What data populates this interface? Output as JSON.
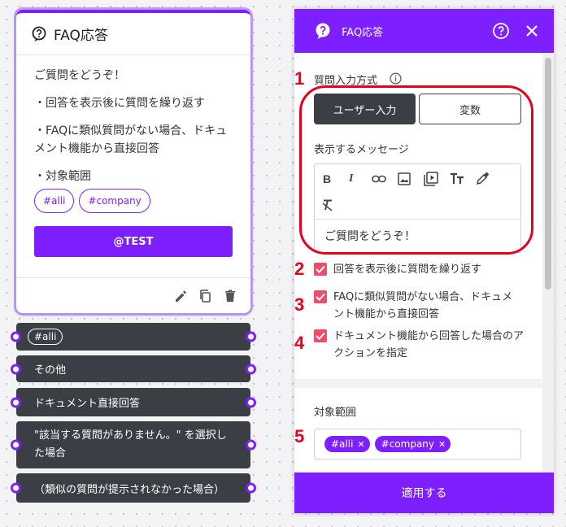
{
  "node": {
    "title": "FAQ応答",
    "lines": [
      "ご質問をどうぞ！",
      "・回答を表示後に質問を繰り返す",
      "・FAQに類似質問がない場合、ドキュメント機能から直接回答",
      "・対象範囲"
    ],
    "chips": [
      "#alli",
      "#company"
    ],
    "test_button": "@TEST"
  },
  "branches": [
    {
      "label": "#alli"
    },
    {
      "label": "その他"
    },
    {
      "label": "ドキュメント直接回答"
    },
    {
      "label": "\"該当する質問がありません。\" を選択した場合"
    },
    {
      "label": "（類似の質問が提示されなかった場合）"
    }
  ],
  "panel": {
    "title": "FAQ応答",
    "input_method_label": "質問入力方式",
    "toggle_user": "ユーザー入力",
    "toggle_var": "変数",
    "message_label": "表示するメッセージ",
    "editor_text": "ご質問をどうぞ！",
    "checkboxes": [
      {
        "text": "回答を表示後に質問を繰り返す",
        "checked": true
      },
      {
        "text": "FAQに類似質問がない場合、ドキュメント機能から直接回答",
        "checked": true
      },
      {
        "text": "ドキュメント機能から回答した場合のアクションを指定",
        "checked": true
      }
    ],
    "scope_label": "対象範囲",
    "scope_tags": [
      "#alli",
      "#company"
    ],
    "apply_button": "適用する"
  },
  "annotations": [
    "1",
    "2",
    "3",
    "4",
    "5"
  ],
  "colors": {
    "accent": "#7e1fff",
    "dark": "#3b3f45",
    "check": "#ec4d6a",
    "annotation": "#e8001c"
  }
}
